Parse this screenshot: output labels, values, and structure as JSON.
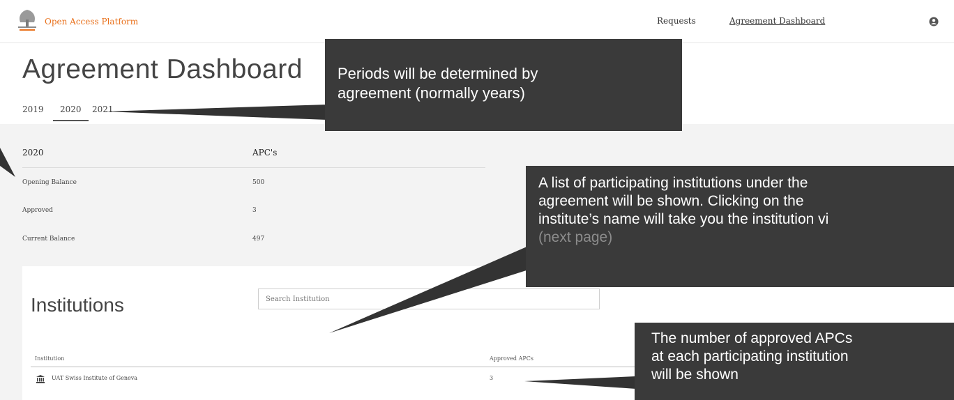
{
  "header": {
    "app_title": "Open Access Platform",
    "nav": {
      "requests": "Requests",
      "dashboard": "Agreement Dashboard"
    },
    "user_icon": "user-circle-icon",
    "logo": "elsevier-logo"
  },
  "page": {
    "title": "Agreement Dashboard",
    "tabs": [
      {
        "label": "2019",
        "active": false
      },
      {
        "label": "2020",
        "active": true
      },
      {
        "label": "2021",
        "active": false
      }
    ]
  },
  "summary": {
    "period": "2020",
    "unit_header": "APC's",
    "rows": [
      {
        "label": "Opening Balance",
        "value": "500"
      },
      {
        "label": "Approved",
        "value": "3"
      },
      {
        "label": "Current Balance",
        "value": "497"
      }
    ]
  },
  "institutions": {
    "title": "Institutions",
    "search_placeholder": "Search Institution",
    "columns": {
      "institution": "Institution",
      "approved": "Approved APCs"
    },
    "rows": [
      {
        "name": "UAT Swiss Institute of Geneva",
        "approved": "3",
        "icon": "bank-icon"
      }
    ]
  },
  "callouts": {
    "periods_line1": "Periods will be determined by",
    "periods_line2": "agreement (normally years)",
    "list_line1": "A list of participating institutions under the",
    "list_line2": "agreement will be shown. Clicking on the",
    "list_line3": "institute’s name will take you the institution vi",
    "list_line4": "(next page)",
    "count_line1": "The number of approved APCs",
    "count_line2": "at each participating institution",
    "count_line3": "will be shown"
  },
  "colors": {
    "brand_orange": "#e9711c",
    "callout_bg": "#3a3a3a",
    "panel_bg": "#f3f3f3"
  }
}
